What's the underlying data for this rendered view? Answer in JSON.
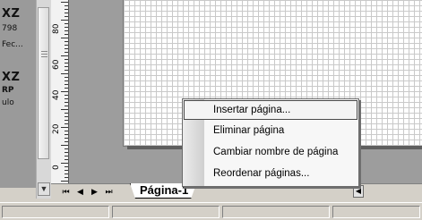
{
  "shapes_panel": {
    "labels": [
      {
        "text": "XZ"
      },
      {
        "text": "798"
      },
      {
        "text": "Fec..."
      },
      {
        "text": "XZ"
      },
      {
        "text": "RP"
      },
      {
        "text": "ulo"
      }
    ]
  },
  "ruler": {
    "ticks": [
      "80",
      "60",
      "40",
      "20",
      "0"
    ]
  },
  "page_tabs": {
    "nav": [
      "⏮",
      "◀",
      "▶",
      "⏭"
    ],
    "active_tab": "Página-1"
  },
  "context_menu": {
    "items": [
      {
        "label": "Insertar página...",
        "highlighted": true
      },
      {
        "label": "Eliminar página",
        "highlighted": false
      },
      {
        "label": "Cambiar nombre de página",
        "highlighted": false
      },
      {
        "label": "Reordenar páginas...",
        "highlighted": false
      }
    ]
  }
}
